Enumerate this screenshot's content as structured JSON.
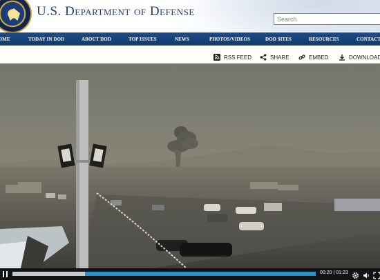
{
  "header": {
    "site_title": "U.S. Department of Defense",
    "search_placeholder": "Search",
    "seal_icon": "dod-seal-icon"
  },
  "nav": {
    "items": [
      {
        "label": "HOME"
      },
      {
        "label": "TODAY IN DOD"
      },
      {
        "label": "ABOUT DOD"
      },
      {
        "label": "TOP ISSUES"
      },
      {
        "label": "NEWS"
      },
      {
        "label": "PHOTOS/VIDEOS"
      },
      {
        "label": "DOD SITES"
      },
      {
        "label": "RESOURCES"
      },
      {
        "label": "CONTACT US"
      }
    ]
  },
  "toolbar": {
    "rss_label": "RSS FEED",
    "share_label": "SHARE",
    "embed_label": "EMBED",
    "download_label": "DOWNLOAD"
  },
  "player": {
    "current_time": "00:20",
    "duration": "01:23",
    "progress_fraction": 0.24,
    "buffered_fraction": 1.0
  },
  "colors": {
    "nav_bg": "#17447c",
    "title_blue": "#1e3f73",
    "progress_blue": "#2f8ec9",
    "controls_bg": "#111315"
  }
}
